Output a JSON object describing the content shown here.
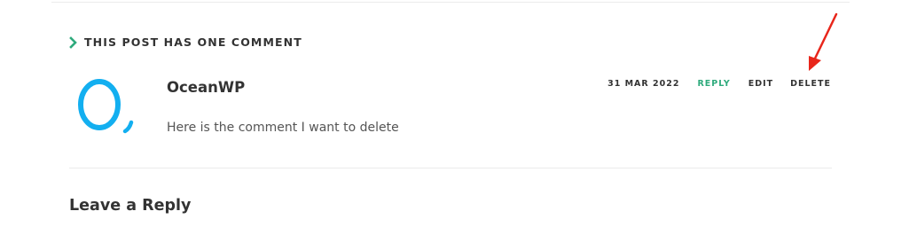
{
  "comments_section": {
    "title": "THIS POST HAS ONE COMMENT",
    "title_icon": "chevron-right-icon",
    "accent_color": "#2eaa7c"
  },
  "comment": {
    "avatar_icon": "oceanwp-logo-icon",
    "avatar_color": "#13aff0",
    "author": "OceanWP",
    "date": "31 MAR 2022",
    "reply_label": "REPLY",
    "edit_label": "EDIT",
    "delete_label": "DELETE",
    "text": "Here is the comment I want to delete"
  },
  "reply_section": {
    "title": "Leave a Reply"
  },
  "annotation": {
    "arrow_icon": "red-arrow-icon",
    "color": "#e8261b"
  }
}
